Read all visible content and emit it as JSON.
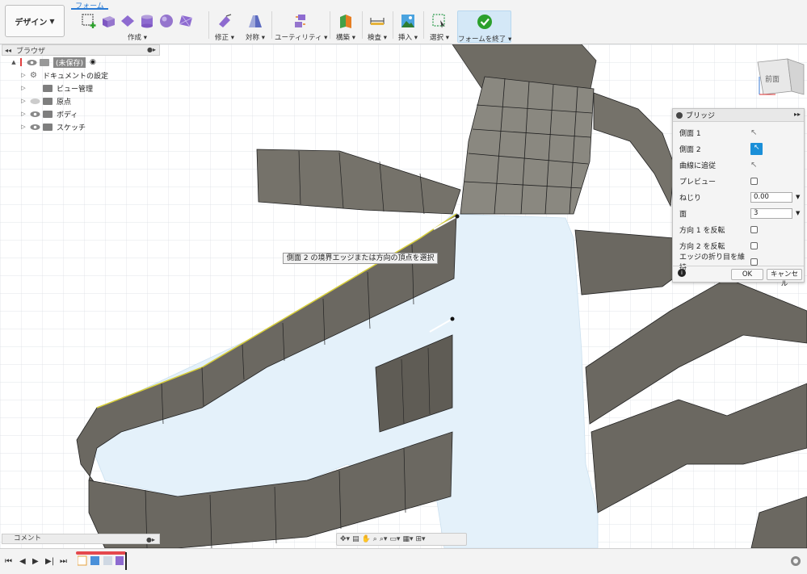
{
  "toolbar": {
    "design_label": "デザイン",
    "active_tab": "フォーム",
    "groups": {
      "create": "作成",
      "modify": "修正",
      "symmetry": "対称",
      "utility": "ユーティリティ",
      "construct": "構築",
      "inspect": "検査",
      "insert": "挿入",
      "select": "選択",
      "finish_form": "フォームを終了"
    }
  },
  "browser": {
    "title": "ブラウザ",
    "items": [
      {
        "label": "(未保存)"
      },
      {
        "label": "ドキュメントの設定"
      },
      {
        "label": "ビュー管理"
      },
      {
        "label": "原点"
      },
      {
        "label": "ボディ"
      },
      {
        "label": "スケッチ"
      }
    ]
  },
  "viewcube": {
    "face": "前面"
  },
  "tooltip": "側面 2 の境界エッジまたは方向の頂点を選択",
  "bridge": {
    "title": "ブリッジ",
    "rows": {
      "side1": "側面 1",
      "side2": "側面 2",
      "follow_curve": "曲線に追従",
      "preview": "プレビュー",
      "twist": "ねじり",
      "twist_value": "0.00",
      "faces": "面",
      "faces_value": "3",
      "flip_dir1": "方向 1 を反転",
      "flip_dir2": "方向 2 を反転",
      "keep_creases": "エッジの折り目を維持"
    },
    "ok": "OK",
    "cancel": "キャンセル"
  },
  "comments": {
    "label": "コメント"
  },
  "colors": {
    "accent": "#1b8fd8",
    "finish_bg": "#d4e8f7",
    "surface": "#6e6b63",
    "face_blue": "#dcecf7",
    "edge_green": "#b8d84c"
  },
  "icons": [
    "create-form-icon",
    "box-icon",
    "plane-icon",
    "cylinder-icon",
    "sphere-icon",
    "quadball-icon",
    "modify-icon",
    "symmetry-icon",
    "utility-icon",
    "construct-icon",
    "inspect-icon",
    "insert-icon",
    "select-icon",
    "check-icon"
  ]
}
